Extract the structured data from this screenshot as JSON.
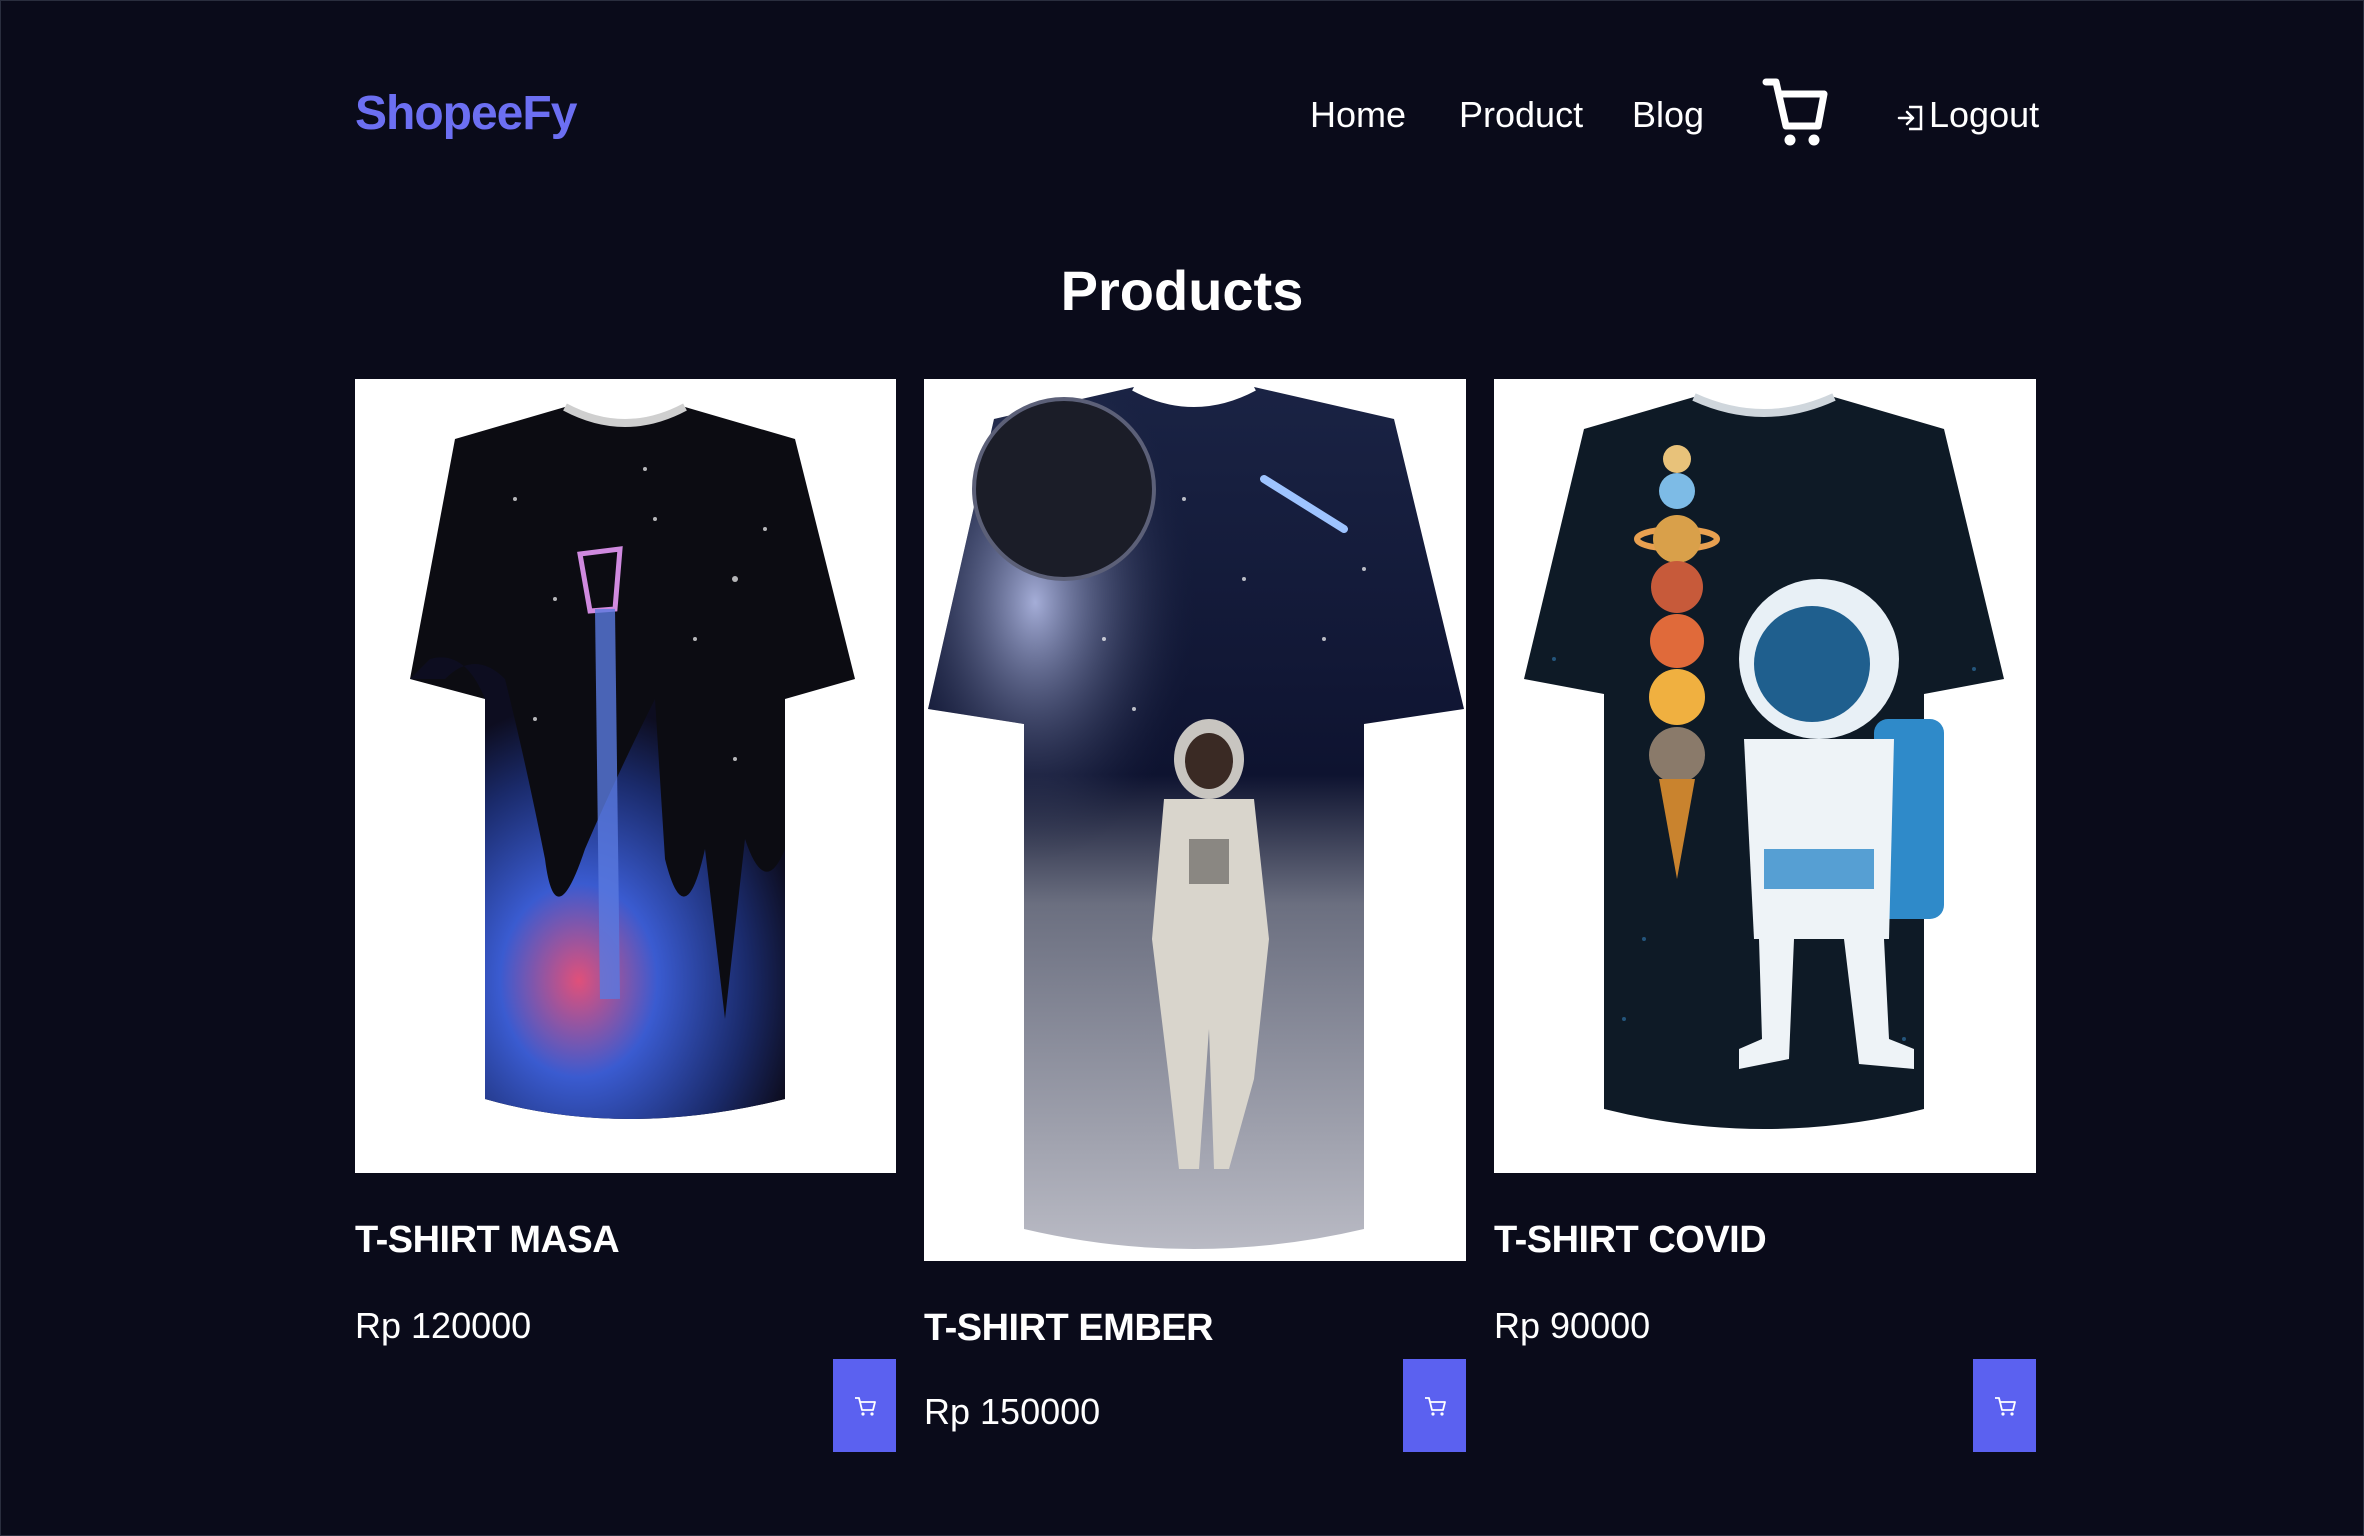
{
  "header": {
    "logo": "ShopeeFy",
    "nav": {
      "home": "Home",
      "product": "Product",
      "blog": "Blog",
      "logout": "Logout"
    },
    "icons": {
      "cart": "cart-icon",
      "logout": "logout-icon"
    }
  },
  "main": {
    "title": "Products",
    "products": [
      {
        "name": "T-SHIRT MASA",
        "price": "Rp 120000",
        "image": "tshirt-galaxy-image"
      },
      {
        "name": "T-SHIRT EMBER",
        "price": "Rp 150000",
        "image": "tshirt-astronaut-moon-image"
      },
      {
        "name": "T-SHIRT COVID",
        "price": "Rp 90000",
        "image": "tshirt-astronaut-icecream-image"
      }
    ]
  },
  "colors": {
    "background": "#0a0b1a",
    "accent": "#6c6ff2",
    "button": "#5b61f0"
  }
}
